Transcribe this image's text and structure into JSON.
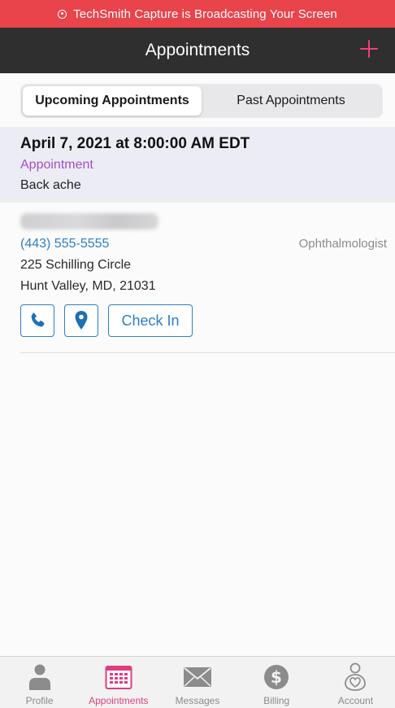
{
  "broadcast": {
    "text": "TechSmith Capture is Broadcasting Your Screen",
    "color": "#e9434b",
    "icon": "record-icon"
  },
  "navbar": {
    "title": "Appointments",
    "add_icon": "plus-icon",
    "accent": "#f0427a"
  },
  "tabs": {
    "upcoming": "Upcoming Appointments",
    "past": "Past Appointments",
    "selected": "upcoming"
  },
  "appointment": {
    "date": "April 7, 2021 at 8:00:00 AM EDT",
    "type": "Appointment",
    "reason": "Back ache",
    "provider": {
      "phone": "(443) 555-5555",
      "specialty": "Ophthalmologist",
      "street": "225 Schilling Circle",
      "city": "Hunt Valley, MD, 21031"
    },
    "actions": {
      "call_icon": "phone-icon",
      "map_icon": "map-pin-icon",
      "checkin_label": "Check In"
    }
  },
  "tabbar": {
    "items": [
      {
        "label": "Profile",
        "icon": "person-icon"
      },
      {
        "label": "Appointments",
        "icon": "calendar-icon",
        "active": true
      },
      {
        "label": "Messages",
        "icon": "envelope-icon"
      },
      {
        "label": "Billing",
        "icon": "dollar-icon"
      },
      {
        "label": "Account",
        "icon": "account-icon"
      }
    ],
    "active_color": "#e23c7e"
  }
}
